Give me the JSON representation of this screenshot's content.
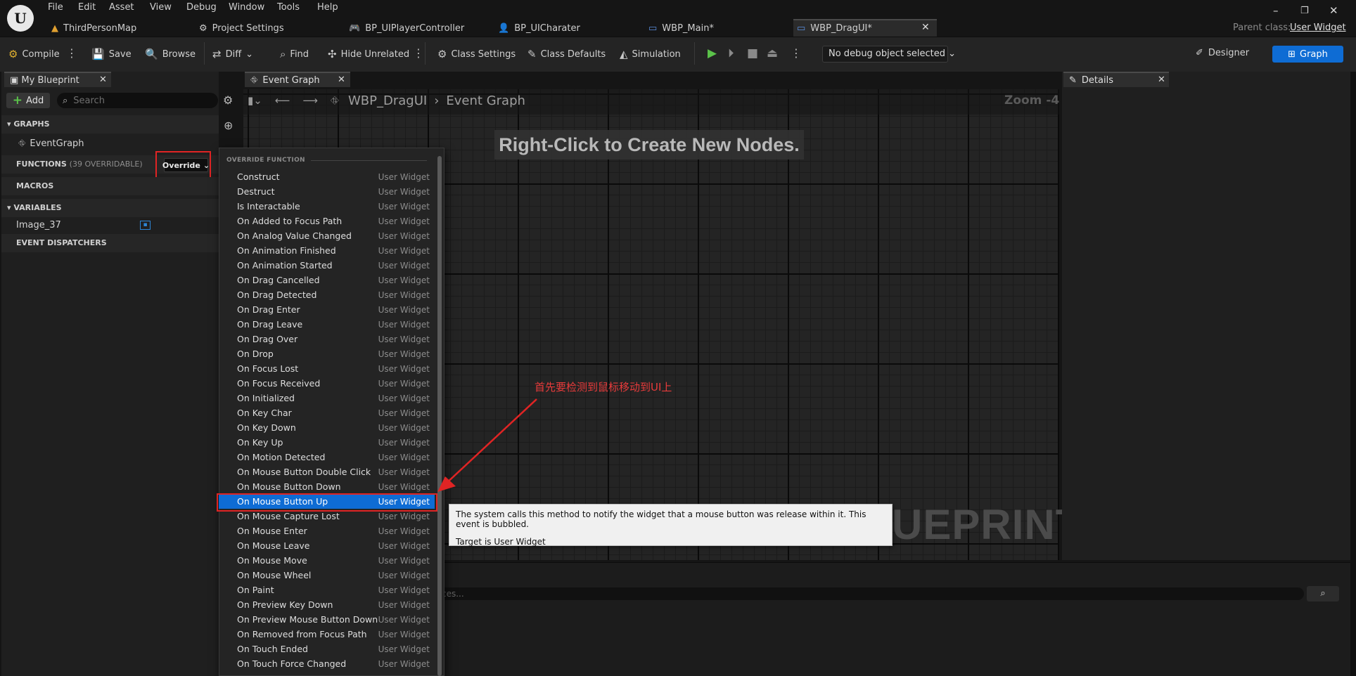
{
  "menu": [
    "File",
    "Edit",
    "Asset",
    "View",
    "Debug",
    "Window",
    "Tools",
    "Help"
  ],
  "tabs": [
    "ThirdPersonMap",
    "Project Settings",
    "BP_UIPlayerController",
    "BP_UICharater",
    "WBP_Main*",
    "WBP_DragUI*"
  ],
  "parent_class": {
    "label": "Parent class:",
    "value": "User Widget"
  },
  "toolbar": {
    "compile": "Compile",
    "save": "Save",
    "browse": "Browse",
    "diff": "Diff",
    "find": "Find",
    "hide_unrelated": "Hide Unrelated",
    "class_settings": "Class Settings",
    "class_defaults": "Class Defaults",
    "simulation": "Simulation",
    "debug_object": "No debug object selected",
    "designer": "Designer",
    "graph": "Graph"
  },
  "my_blueprint": {
    "tab": "My Blueprint",
    "add": "Add",
    "search_placeholder": "Search",
    "sections": {
      "graphs": "GRAPHS",
      "functions": "FUNCTIONS",
      "functions_sub": "(39 OVERRIDABLE)",
      "macros": "MACROS",
      "variables": "VARIABLES",
      "event_dispatchers": "EVENT DISPATCHERS"
    },
    "graph_item": "EventGraph",
    "variable_item": "Image_37",
    "override_button": "Override"
  },
  "graph": {
    "tab": "Event Graph",
    "breadcrumb_root": "WBP_DragUI",
    "breadcrumb_leaf": "Event Graph",
    "zoom": "Zoom -4",
    "hint": "Right-Click to Create New Nodes.",
    "watermark": "UEPRINT"
  },
  "details": {
    "tab": "Details"
  },
  "bottom": {
    "search_placeholder": "ces..."
  },
  "override_menu": {
    "heading": "OVERRIDE FUNCTION",
    "owner": "User Widget",
    "selected_index": 22,
    "items": [
      "Construct",
      "Destruct",
      "Is Interactable",
      "On Added to Focus Path",
      "On Analog Value Changed",
      "On Animation Finished",
      "On Animation Started",
      "On Drag Cancelled",
      "On Drag Detected",
      "On Drag Enter",
      "On Drag Leave",
      "On Drag Over",
      "On Drop",
      "On Focus Lost",
      "On Focus Received",
      "On Initialized",
      "On Key Char",
      "On Key Down",
      "On Key Up",
      "On Motion Detected",
      "On Mouse Button Double Click",
      "On Mouse Button Down",
      "On Mouse Button Up",
      "On Mouse Capture Lost",
      "On Mouse Enter",
      "On Mouse Leave",
      "On Mouse Move",
      "On Mouse Wheel",
      "On Paint",
      "On Preview Key Down",
      "On Preview Mouse Button Down",
      "On Removed from Focus Path",
      "On Touch Ended",
      "On Touch Force Changed"
    ]
  },
  "tooltip": {
    "line1": "The system calls this method to notify the widget that a mouse button was release within it. This event is bubbled.",
    "line2": "Target is User Widget"
  },
  "annotation": {
    "text": "首先要检测到鼠标移动到UI上",
    "color": "#e83b3b"
  },
  "colors": {
    "accent": "#0e6cd4",
    "highlight": "#e02424",
    "play": "#5bc24a"
  }
}
